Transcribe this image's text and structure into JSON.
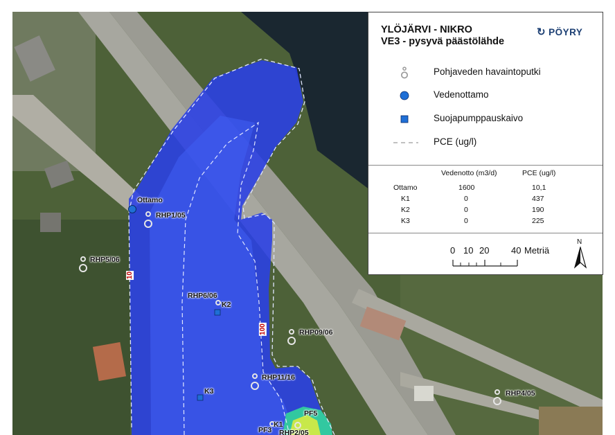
{
  "legend": {
    "title_line1": "YLÖJÄRVI - NIKRO",
    "title_line2": "VE3 - pysyvä päästölähde",
    "logo_text": "PÖYRY",
    "items": [
      {
        "icon": "observation-well-icon",
        "label": "Pohjaveden havaintoputki"
      },
      {
        "icon": "water-intake-icon",
        "label": "Vedenottamo",
        "color": "#1f6fd6"
      },
      {
        "icon": "protective-pump-well-icon",
        "label": "Suojapumppauskaivo",
        "color": "#1f6fd6"
      },
      {
        "icon": "contour-line-icon",
        "label": "PCE (ug/l)"
      }
    ]
  },
  "table": {
    "headers": [
      "",
      "Vedenotto (m3/d)",
      "PCE (ug/l)"
    ],
    "rows": [
      [
        "Ottamo",
        "1600",
        "10,1"
      ],
      [
        "K1",
        "0",
        "437"
      ],
      [
        "K2",
        "0",
        "190"
      ],
      [
        "K3",
        "0",
        "225"
      ]
    ]
  },
  "scale": {
    "ticks": [
      "0",
      "10",
      "20",
      "40"
    ],
    "unit": "Metriä",
    "north": "N"
  },
  "map": {
    "labels": {
      "ottamo": "Ottamo",
      "rhp1_05": "RHP1/05",
      "rhp5_06": "RHP5/06",
      "rhp6_06": "RHP6/06",
      "k2": "K2",
      "rhp09_06": "RHP09/06",
      "rhp11_16": "RHP11/16",
      "k3": "K3",
      "rhp4_05": "RHP4/05",
      "pf5": "PF5",
      "k1": "K1",
      "pf3": "PF3",
      "rhp2_05": "RHP2/05"
    },
    "contours": {
      "c10": "10",
      "c100": "100"
    },
    "colors": {
      "plume": "#2a46e8",
      "plume_inner": "#3c5cf0",
      "lake": "#1b2a35",
      "road": "#a8a8a0",
      "vegetation": "#3f5a2e"
    }
  }
}
